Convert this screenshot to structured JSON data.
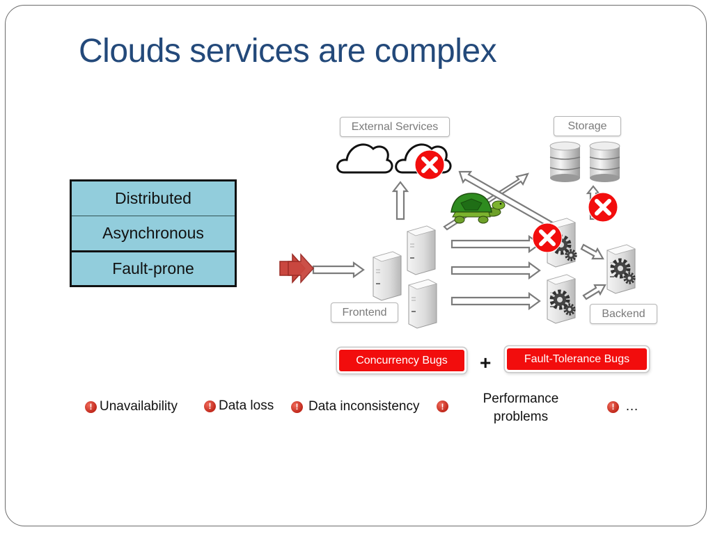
{
  "slide": {
    "title": "Clouds services are complex"
  },
  "properties": [
    "Distributed",
    "Asynchronous",
    "Fault-prone"
  ],
  "diagram": {
    "labels": {
      "external_services": "External Services",
      "storage": "Storage",
      "frontend": "Frontend",
      "backend": "Backend"
    },
    "icons": {
      "cloud": "cloud-icon",
      "database": "database-icon",
      "server": "server-icon",
      "gear_server": "gear-server-icon",
      "error": "red-x-icon",
      "turtle": "turtle-icon",
      "input_arrow": "red-double-arrow-icon"
    }
  },
  "bugs": {
    "concurrency": "Concurrency Bugs",
    "plus": "+",
    "fault_tolerance": "Fault-Tolerance Bugs"
  },
  "impacts": [
    {
      "label": "Unavailability"
    },
    {
      "label": "Data loss"
    },
    {
      "label": "Data inconsistency"
    },
    {
      "label": "Performance problems",
      "line1": "Performance",
      "line2": "problems"
    },
    {
      "label": "…"
    }
  ],
  "colors": {
    "title": "#23497a",
    "property_fill": "#92cddc",
    "bug_fill": "#f20d0d",
    "error_icon": "#f20d0d",
    "turtle": "#2e8b1f"
  }
}
